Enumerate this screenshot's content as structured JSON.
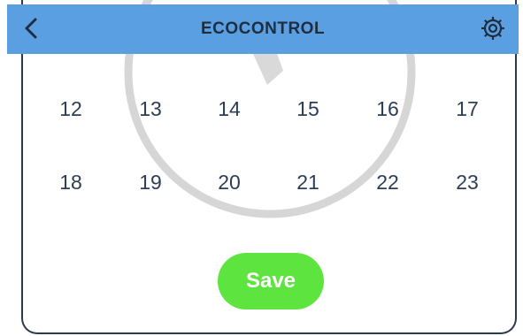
{
  "header": {
    "title": "ECOCONTROL",
    "back_icon": "chevron-left-icon",
    "settings_icon": "gear-icon",
    "color": "#5b9fe3"
  },
  "hours": {
    "row1": [
      "12",
      "13",
      "14",
      "15",
      "16",
      "17"
    ],
    "row2": [
      "18",
      "19",
      "20",
      "21",
      "22",
      "23"
    ]
  },
  "save_button": {
    "label": "Save",
    "color": "#5ee43e"
  }
}
